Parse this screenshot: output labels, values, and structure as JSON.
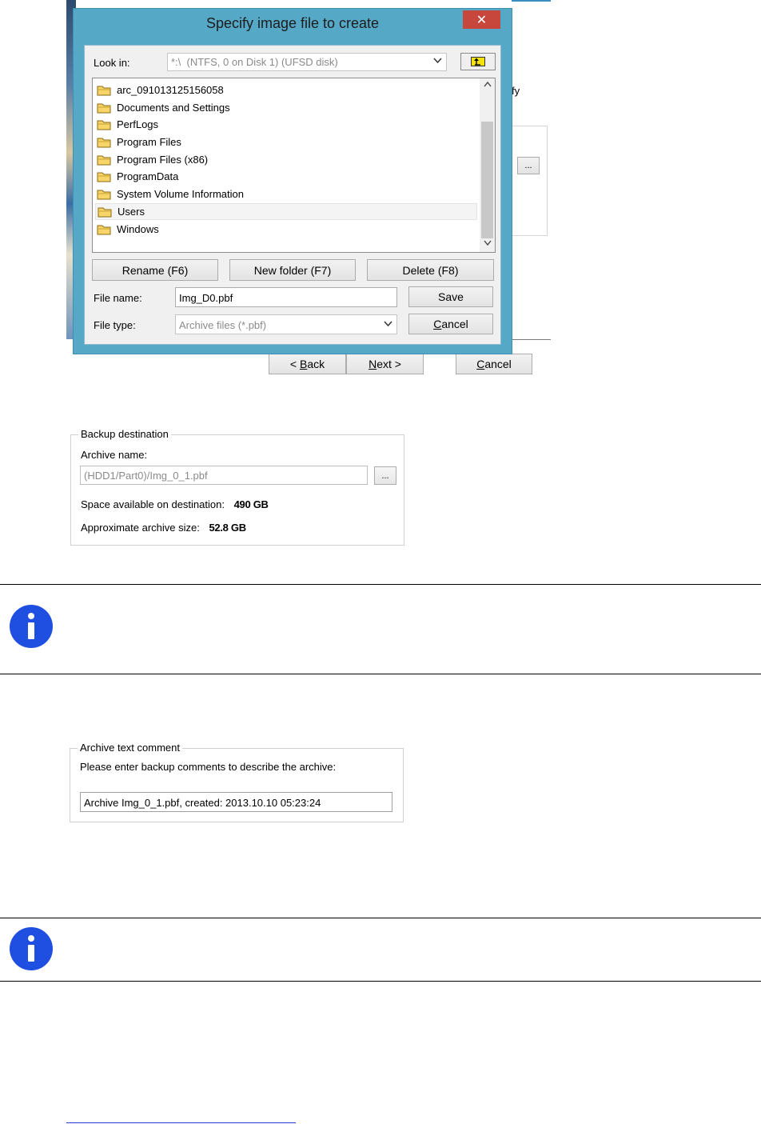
{
  "background_wizard": {
    "partial_text": "fy",
    "browse_label": "...",
    "buttons": {
      "back": {
        "prefix": "< ",
        "mnemonic": "B",
        "rest": "ack"
      },
      "next": {
        "mnemonic": "N",
        "rest": "ext >"
      },
      "cancel": {
        "mnemonic": "C",
        "rest": "ancel"
      }
    }
  },
  "dialog": {
    "title": "Specify image file to create",
    "close_glyph": "✕",
    "look_in_label": "Look in:",
    "look_in_value": "*:\\  (NTFS, 0 on Disk 1) (UFSD disk)",
    "folders": [
      "arc_091013125156058",
      "Documents and Settings",
      "PerfLogs",
      "Program Files",
      "Program Files (x86)",
      "ProgramData",
      "System Volume Information",
      "Users",
      "Windows"
    ],
    "selected_folder": "Users",
    "rename_label": "Rename (F6)",
    "new_folder_label": "New folder (F7)",
    "delete_label": "Delete (F8)",
    "file_name_label": "File name:",
    "file_name_value": "Img_D0.pbf",
    "file_type_label": "File type:",
    "file_type_value": "Archive files (*.pbf)",
    "save_label": "Save",
    "cancel": {
      "mnemonic": "C",
      "rest": "ancel"
    }
  },
  "backup_destination": {
    "title": "Backup destination",
    "archive_name_label": "Archive name:",
    "archive_name_value": "(HDD1/Part0)/Img_0_1.pbf",
    "browse_label": "...",
    "space_label": "Space available on destination:",
    "space_value": "490 GB",
    "size_label": "Approximate archive size:",
    "size_value": "52.8 GB"
  },
  "archive_comment": {
    "title": "Archive text comment",
    "prompt": "Please enter backup comments to describe the archive:",
    "value": "Archive Img_0_1.pbf, created: 2013.10.10 05:23:24"
  },
  "colors": {
    "dialog_frame": "#56a8c7",
    "close_button": "#c7473c",
    "info_icon": "#1f4fe0",
    "up_folder_icon": "#f4e20e"
  },
  "icons": {
    "info": "info-icon",
    "folder": "folder-icon",
    "up_folder": "up-folder-icon"
  }
}
